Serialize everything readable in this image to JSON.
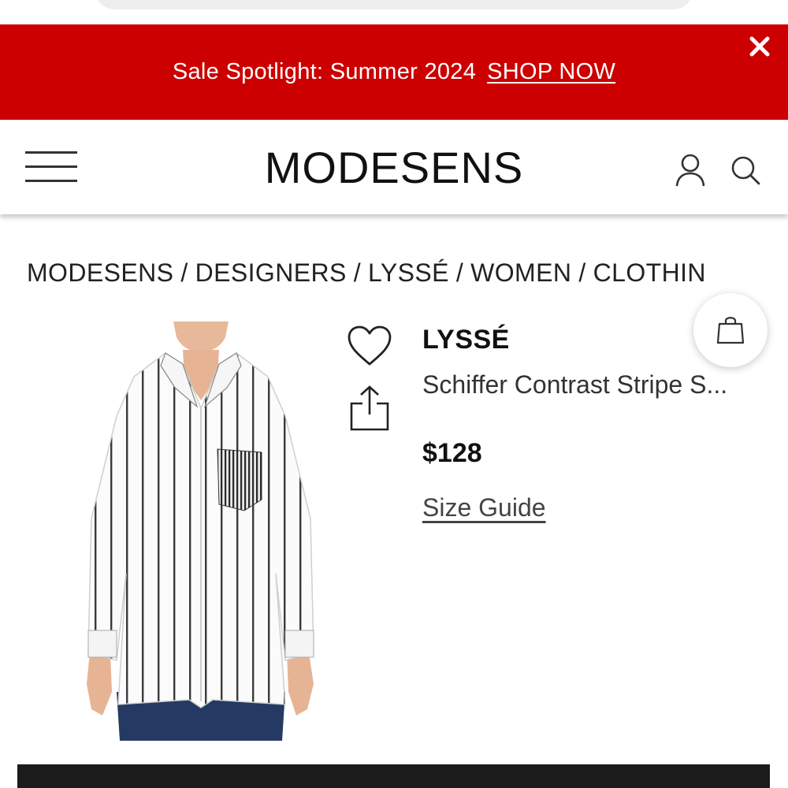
{
  "promo": {
    "text": "Sale Spotlight: Summer 2024",
    "link_label": "SHOP NOW",
    "background_color": "#cc0000"
  },
  "header": {
    "logo": "MODESENS",
    "menu_icon": "hamburger-menu-icon",
    "account_icon": "user-icon",
    "search_icon": "search-icon"
  },
  "breadcrumb": [
    "MODESENS",
    "DESIGNERS",
    "LYSSÉ",
    "WOMEN",
    "CLOTHIN"
  ],
  "product": {
    "brand": "LYSSÉ",
    "name": "Schiffer Contrast Stripe S...",
    "price": "$128",
    "size_guide_label": "Size Guide",
    "image_icon": "striped-shirt-image"
  },
  "actions": {
    "wishlist_icon": "heart-icon",
    "share_icon": "share-icon",
    "bag_icon": "shopping-bag-icon"
  }
}
